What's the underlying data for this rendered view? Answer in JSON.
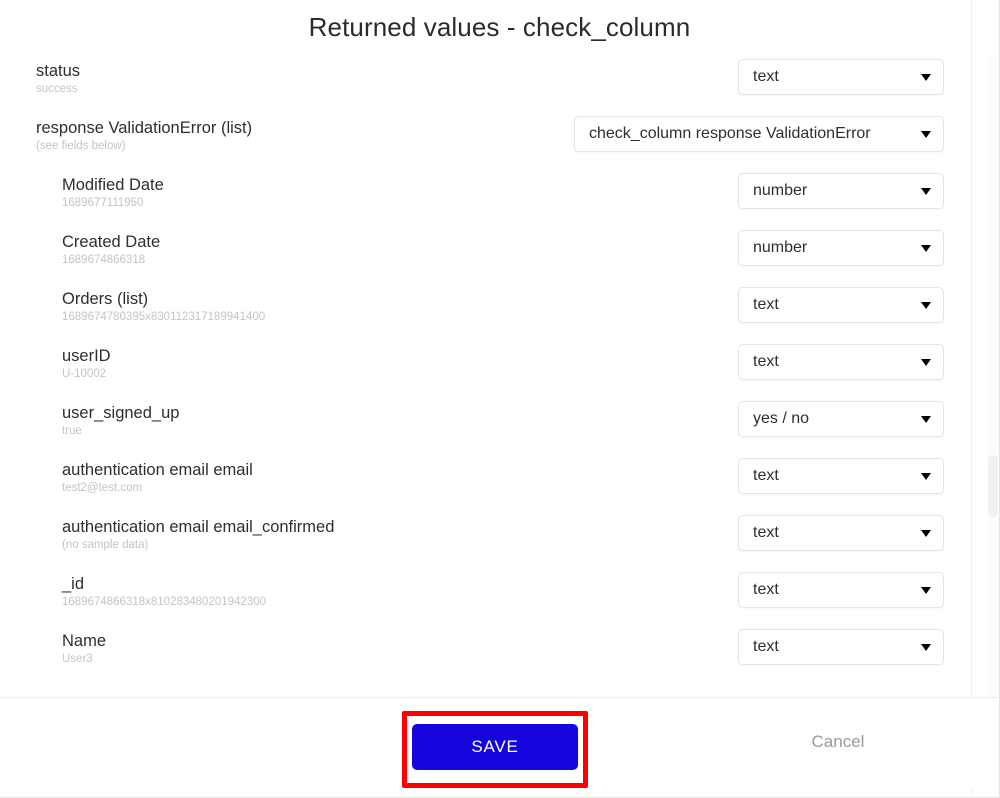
{
  "dialog": {
    "title": "Returned values - check_column"
  },
  "rows": [
    {
      "name": "status",
      "sample": "success",
      "indent": false,
      "type": "text",
      "wide": false
    },
    {
      "name": "response ValidationError (list)",
      "sample": "(see fields below)",
      "indent": false,
      "type": "check_column response ValidationError",
      "wide": true
    },
    {
      "name": "Modified Date",
      "sample": "1689677111950",
      "indent": true,
      "type": "number",
      "wide": false
    },
    {
      "name": "Created Date",
      "sample": "1689674866318",
      "indent": true,
      "type": "number",
      "wide": false
    },
    {
      "name": "Orders (list)",
      "sample": "1689674780395x830112317189941400",
      "indent": true,
      "type": "text",
      "wide": false
    },
    {
      "name": "userID",
      "sample": "U-10002",
      "indent": true,
      "type": "text",
      "wide": false
    },
    {
      "name": "user_signed_up",
      "sample": "true",
      "indent": true,
      "type": "yes / no",
      "wide": false
    },
    {
      "name": "authentication email email",
      "sample": "test2@test.com",
      "indent": true,
      "type": "text",
      "wide": false
    },
    {
      "name": "authentication email email_confirmed",
      "sample": "(no sample data)",
      "indent": true,
      "type": "text",
      "wide": false
    },
    {
      "name": "_id",
      "sample": "1689674866318x810283480201942300",
      "indent": true,
      "type": "text",
      "wide": false
    },
    {
      "name": "Name",
      "sample": "User3",
      "indent": true,
      "type": "text",
      "wide": false
    }
  ],
  "footer": {
    "save_label": "SAVE",
    "cancel_label": "Cancel"
  },
  "colors": {
    "save_blue": "#1505dc",
    "annotation_red": "#ff0000",
    "field_name": "#2e2e2e",
    "sample_gray": "#c4c4c4"
  },
  "icons": {
    "caret": "chevron-down-icon"
  }
}
